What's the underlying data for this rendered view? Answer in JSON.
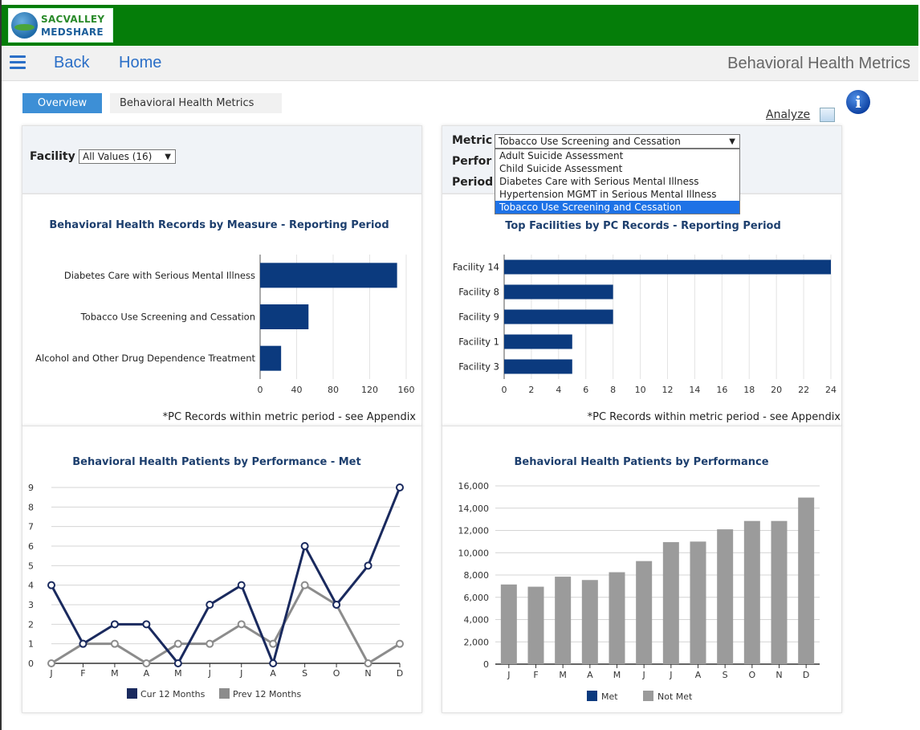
{
  "app": {
    "logo_line1": "SACVALLEY",
    "logo_line2": "MEDSHARE",
    "nav_back": "Back",
    "nav_home": "Home",
    "page_title": "Behavioral Health Metrics"
  },
  "tabs": [
    {
      "label": "Overview",
      "active": true
    },
    {
      "label": "Behavioral Health Metrics",
      "active": false
    }
  ],
  "toolbar": {
    "analyze_label": "Analyze",
    "info_glyph": "i"
  },
  "filters": {
    "facility_label": "Facility",
    "facility_value": "All Values (16)",
    "metric_label": "Metric",
    "metric_value": "Tobacco Use Screening and Cessation",
    "performance_label": "Perfor",
    "period_label": "Period",
    "metric_options": [
      "Adult Suicide Assessment",
      "Child Suicide Assessment",
      "Diabetes Care with Serious Mental Illness",
      "Hypertension MGMT in Serious Mental Illness",
      "Tobacco Use Screening and Cessation"
    ],
    "metric_selected_index": 4
  },
  "chart_data": [
    {
      "type": "bar",
      "orientation": "horizontal",
      "title": "Behavioral Health Records by Measure - Reporting Period",
      "categories": [
        "Diabetes Care with Serious Mental Illness",
        "Tobacco Use Screening and Cessation",
        "Alcohol and Other Drug Dependence Treatment"
      ],
      "values": [
        150,
        53,
        23
      ],
      "xlim": [
        0,
        160
      ],
      "xticks": [
        "0",
        "40",
        "80",
        "120",
        "160"
      ],
      "footnote": "*PC Records within metric period - see Appendix",
      "color": "#0b3a7e"
    },
    {
      "type": "bar",
      "orientation": "horizontal",
      "title": "Top Facilities by PC Records - Reporting Period",
      "categories": [
        "Facility 14",
        "Facility 8",
        "Facility 9",
        "Facility 1",
        "Facility 3"
      ],
      "values": [
        24,
        8,
        8,
        5,
        5
      ],
      "xlim": [
        0,
        24
      ],
      "xticks": [
        "0",
        "2",
        "4",
        "6",
        "8",
        "10",
        "12",
        "14",
        "16",
        "18",
        "20",
        "22",
        "24"
      ],
      "footnote": "*PC Records within metric period - see Appendix",
      "color": "#0b3a7e"
    },
    {
      "type": "line",
      "title": "Behavioral Health Patients by Performance - Met",
      "categories": [
        "J",
        "F",
        "M",
        "A",
        "M",
        "J",
        "J",
        "A",
        "S",
        "O",
        "N",
        "D"
      ],
      "ylim": [
        0,
        9
      ],
      "yticks": [
        "0",
        "1",
        "2",
        "3",
        "4",
        "5",
        "6",
        "7",
        "8",
        "9"
      ],
      "series": [
        {
          "name": "Cur 12 Months",
          "color": "#1a2a5e",
          "values": [
            4,
            1,
            2,
            2,
            0,
            3,
            4,
            0,
            6,
            3,
            5,
            9
          ]
        },
        {
          "name": "Prev 12 Months",
          "color": "#8c8c8c",
          "values": [
            0,
            1,
            1,
            0,
            1,
            1,
            2,
            1,
            4,
            3,
            0,
            1
          ]
        }
      ],
      "legend_position": "bottom"
    },
    {
      "type": "bar",
      "title": "Behavioral Health Patients by Performance",
      "categories": [
        "J",
        "F",
        "M",
        "A",
        "M",
        "J",
        "J",
        "A",
        "S",
        "O",
        "N",
        "D"
      ],
      "ylim": [
        0,
        16000
      ],
      "yticks": [
        "0",
        "2,000",
        "4,000",
        "6,000",
        "8,000",
        "10,000",
        "12,000",
        "14,000",
        "16,000"
      ],
      "series": [
        {
          "name": "Met",
          "color": "#0b3a7e",
          "values": [
            0,
            0,
            0,
            0,
            0,
            0,
            0,
            0,
            0,
            0,
            0,
            0
          ]
        },
        {
          "name": "Not Met",
          "color": "#9b9b9b",
          "values": [
            7150,
            6950,
            7850,
            7550,
            8250,
            9250,
            10950,
            11000,
            12100,
            12850,
            12850,
            14950
          ]
        }
      ],
      "legend_position": "bottom"
    }
  ]
}
